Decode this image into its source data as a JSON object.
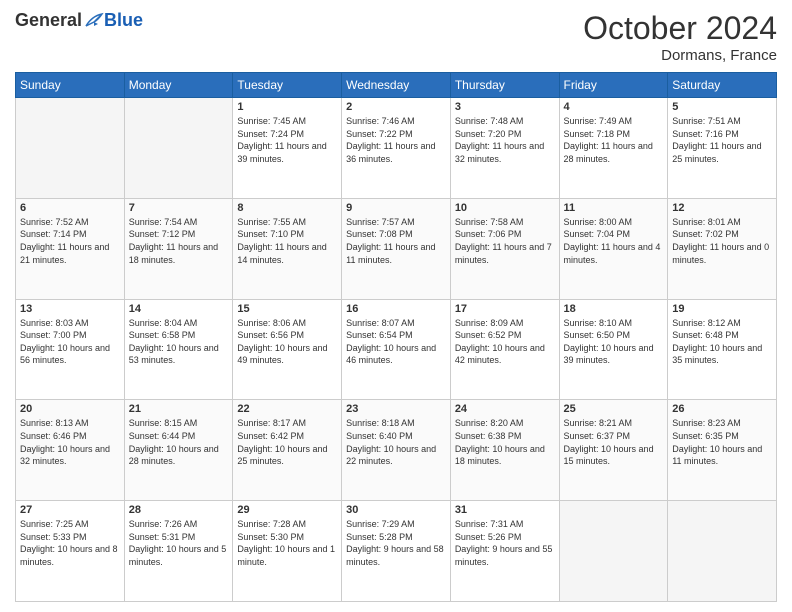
{
  "header": {
    "logo": {
      "general": "General",
      "blue": "Blue"
    },
    "title": "October 2024",
    "location": "Dormans, France"
  },
  "calendar": {
    "days_of_week": [
      "Sunday",
      "Monday",
      "Tuesday",
      "Wednesday",
      "Thursday",
      "Friday",
      "Saturday"
    ],
    "weeks": [
      [
        {
          "day": null
        },
        {
          "day": null
        },
        {
          "day": "1",
          "sunrise": "7:45 AM",
          "sunset": "7:24 PM",
          "daylight": "11 hours and 39 minutes."
        },
        {
          "day": "2",
          "sunrise": "7:46 AM",
          "sunset": "7:22 PM",
          "daylight": "11 hours and 36 minutes."
        },
        {
          "day": "3",
          "sunrise": "7:48 AM",
          "sunset": "7:20 PM",
          "daylight": "11 hours and 32 minutes."
        },
        {
          "day": "4",
          "sunrise": "7:49 AM",
          "sunset": "7:18 PM",
          "daylight": "11 hours and 28 minutes."
        },
        {
          "day": "5",
          "sunrise": "7:51 AM",
          "sunset": "7:16 PM",
          "daylight": "11 hours and 25 minutes."
        }
      ],
      [
        {
          "day": "6",
          "sunrise": "7:52 AM",
          "sunset": "7:14 PM",
          "daylight": "11 hours and 21 minutes."
        },
        {
          "day": "7",
          "sunrise": "7:54 AM",
          "sunset": "7:12 PM",
          "daylight": "11 hours and 18 minutes."
        },
        {
          "day": "8",
          "sunrise": "7:55 AM",
          "sunset": "7:10 PM",
          "daylight": "11 hours and 14 minutes."
        },
        {
          "day": "9",
          "sunrise": "7:57 AM",
          "sunset": "7:08 PM",
          "daylight": "11 hours and 11 minutes."
        },
        {
          "day": "10",
          "sunrise": "7:58 AM",
          "sunset": "7:06 PM",
          "daylight": "11 hours and 7 minutes."
        },
        {
          "day": "11",
          "sunrise": "8:00 AM",
          "sunset": "7:04 PM",
          "daylight": "11 hours and 4 minutes."
        },
        {
          "day": "12",
          "sunrise": "8:01 AM",
          "sunset": "7:02 PM",
          "daylight": "11 hours and 0 minutes."
        }
      ],
      [
        {
          "day": "13",
          "sunrise": "8:03 AM",
          "sunset": "7:00 PM",
          "daylight": "10 hours and 56 minutes."
        },
        {
          "day": "14",
          "sunrise": "8:04 AM",
          "sunset": "6:58 PM",
          "daylight": "10 hours and 53 minutes."
        },
        {
          "day": "15",
          "sunrise": "8:06 AM",
          "sunset": "6:56 PM",
          "daylight": "10 hours and 49 minutes."
        },
        {
          "day": "16",
          "sunrise": "8:07 AM",
          "sunset": "6:54 PM",
          "daylight": "10 hours and 46 minutes."
        },
        {
          "day": "17",
          "sunrise": "8:09 AM",
          "sunset": "6:52 PM",
          "daylight": "10 hours and 42 minutes."
        },
        {
          "day": "18",
          "sunrise": "8:10 AM",
          "sunset": "6:50 PM",
          "daylight": "10 hours and 39 minutes."
        },
        {
          "day": "19",
          "sunrise": "8:12 AM",
          "sunset": "6:48 PM",
          "daylight": "10 hours and 35 minutes."
        }
      ],
      [
        {
          "day": "20",
          "sunrise": "8:13 AM",
          "sunset": "6:46 PM",
          "daylight": "10 hours and 32 minutes."
        },
        {
          "day": "21",
          "sunrise": "8:15 AM",
          "sunset": "6:44 PM",
          "daylight": "10 hours and 28 minutes."
        },
        {
          "day": "22",
          "sunrise": "8:17 AM",
          "sunset": "6:42 PM",
          "daylight": "10 hours and 25 minutes."
        },
        {
          "day": "23",
          "sunrise": "8:18 AM",
          "sunset": "6:40 PM",
          "daylight": "10 hours and 22 minutes."
        },
        {
          "day": "24",
          "sunrise": "8:20 AM",
          "sunset": "6:38 PM",
          "daylight": "10 hours and 18 minutes."
        },
        {
          "day": "25",
          "sunrise": "8:21 AM",
          "sunset": "6:37 PM",
          "daylight": "10 hours and 15 minutes."
        },
        {
          "day": "26",
          "sunrise": "8:23 AM",
          "sunset": "6:35 PM",
          "daylight": "10 hours and 11 minutes."
        }
      ],
      [
        {
          "day": "27",
          "sunrise": "7:25 AM",
          "sunset": "5:33 PM",
          "daylight": "10 hours and 8 minutes."
        },
        {
          "day": "28",
          "sunrise": "7:26 AM",
          "sunset": "5:31 PM",
          "daylight": "10 hours and 5 minutes."
        },
        {
          "day": "29",
          "sunrise": "7:28 AM",
          "sunset": "5:30 PM",
          "daylight": "10 hours and 1 minute."
        },
        {
          "day": "30",
          "sunrise": "7:29 AM",
          "sunset": "5:28 PM",
          "daylight": "9 hours and 58 minutes."
        },
        {
          "day": "31",
          "sunrise": "7:31 AM",
          "sunset": "5:26 PM",
          "daylight": "9 hours and 55 minutes."
        },
        {
          "day": null
        },
        {
          "day": null
        }
      ]
    ]
  }
}
